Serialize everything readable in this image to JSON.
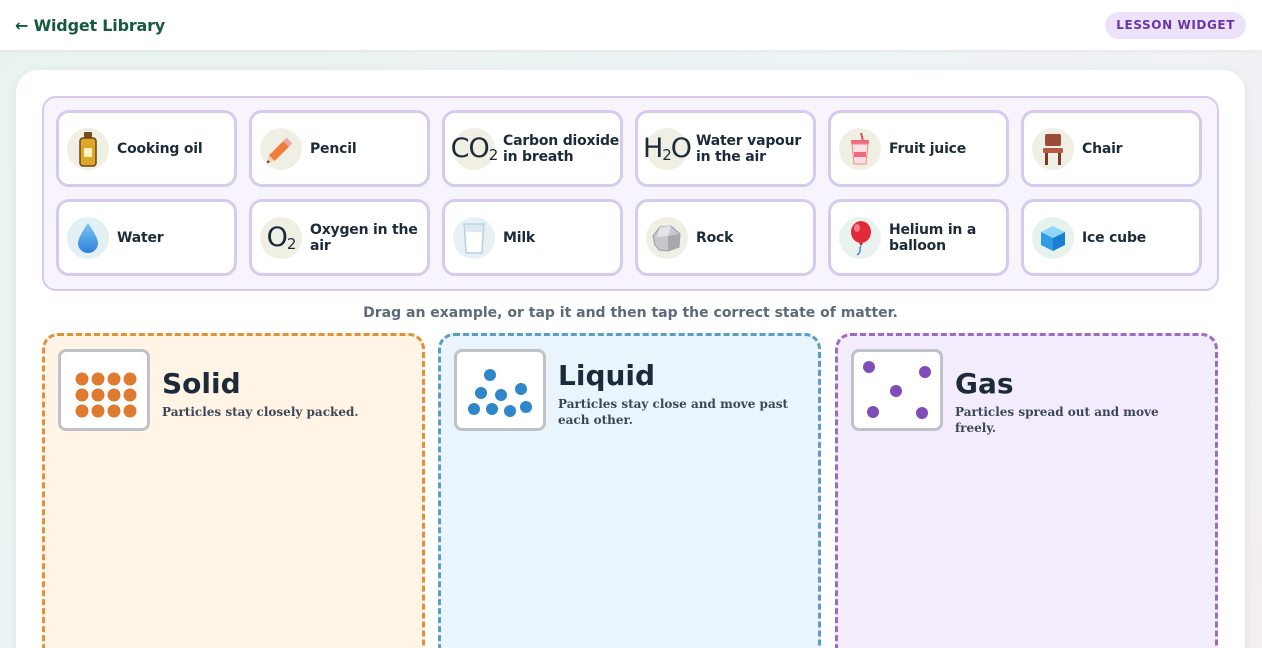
{
  "header": {
    "back_label": "← Widget Library",
    "badge": "LESSON WIDGET"
  },
  "bank": {
    "items": [
      {
        "label": "Cooking oil",
        "icon": "oil-bottle-icon"
      },
      {
        "label": "Pencil",
        "icon": "pencil-icon"
      },
      {
        "label": "Carbon dioxide in breath",
        "icon": "co2-formula-icon",
        "formula": "CO",
        "sub": "2"
      },
      {
        "label": "Water vapour in the air",
        "icon": "h2o-formula-icon",
        "formula": "H",
        "sub": "2",
        "formula_tail": "O"
      },
      {
        "label": "Fruit juice",
        "icon": "juice-cup-icon"
      },
      {
        "label": "Chair",
        "icon": "chair-icon"
      },
      {
        "label": "Water",
        "icon": "water-drop-icon"
      },
      {
        "label": "Oxygen in the air",
        "icon": "o2-formula-icon",
        "formula": "O",
        "sub": "2"
      },
      {
        "label": "Milk",
        "icon": "milk-glass-icon"
      },
      {
        "label": "Rock",
        "icon": "rock-icon"
      },
      {
        "label": "Helium in a balloon",
        "icon": "balloon-icon"
      },
      {
        "label": "Ice cube",
        "icon": "ice-cube-icon"
      }
    ]
  },
  "instruction": "Drag an example, or tap it and then tap the correct state of matter.",
  "zones": [
    {
      "title": "Solid",
      "desc": "Particles stay closely packed.",
      "color": "#e0913a",
      "bg": "#fff4e6",
      "dot": "#e07a30"
    },
    {
      "title": "Liquid",
      "desc": "Particles stay close and move past each other.",
      "color": "#5b9dc4",
      "bg": "#e9f4fd",
      "dot": "#2f86c8"
    },
    {
      "title": "Gas",
      "desc": "Particles spread out and move freely.",
      "color": "#9a6cc4",
      "bg": "#f2ecfc",
      "dot": "#7e4dba"
    }
  ]
}
